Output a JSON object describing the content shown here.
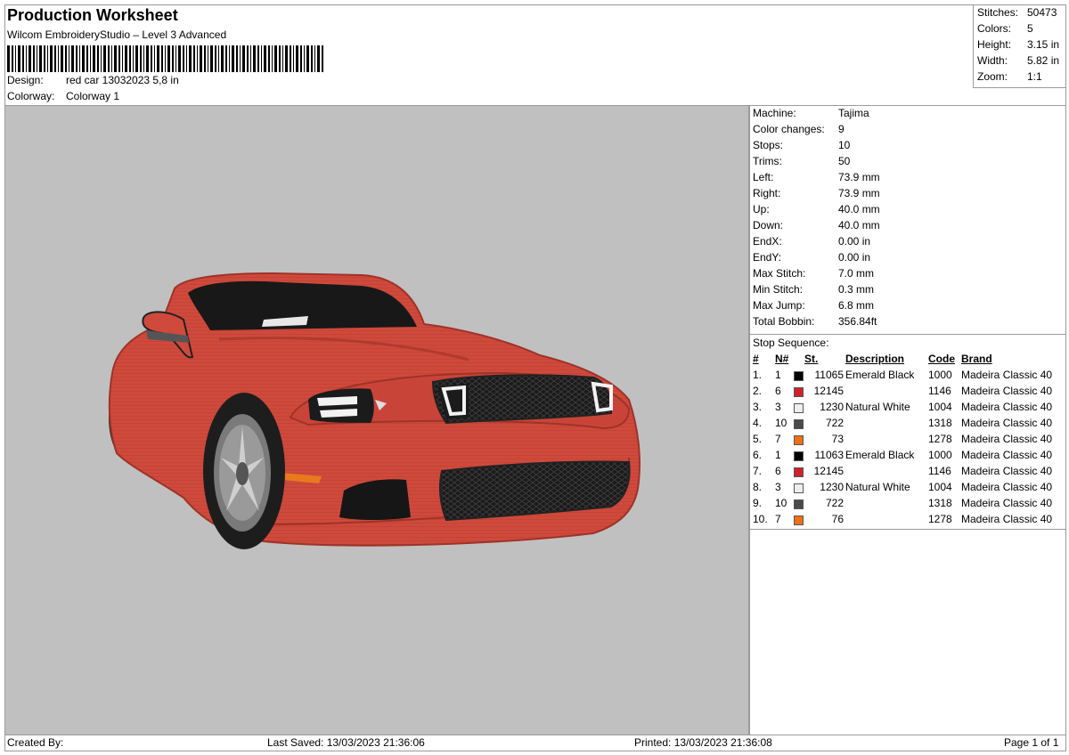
{
  "header": {
    "title": "Production Worksheet",
    "subtitle": "Wilcom EmbroideryStudio – Level 3 Advanced",
    "design_label": "Design:",
    "design_value": "red car 13032023 5,8 in",
    "colorway_label": "Colorway:",
    "colorway_value": "Colorway 1"
  },
  "stats": [
    {
      "label": "Stitches:",
      "value": "50473"
    },
    {
      "label": "Colors:",
      "value": "5"
    },
    {
      "label": "Height:",
      "value": "3.15 in"
    },
    {
      "label": "Width:",
      "value": "5.82 in"
    },
    {
      "label": "Zoom:",
      "value": "1:1"
    }
  ],
  "machine": [
    {
      "label": "Machine:",
      "value": "Tajima"
    },
    {
      "label": "Color changes:",
      "value": "9"
    },
    {
      "label": "Stops:",
      "value": "10"
    },
    {
      "label": "Trims:",
      "value": "50"
    },
    {
      "label": "Left:",
      "value": "73.9 mm"
    },
    {
      "label": "Right:",
      "value": "73.9 mm"
    },
    {
      "label": "Up:",
      "value": "40.0 mm"
    },
    {
      "label": "Down:",
      "value": "40.0 mm"
    },
    {
      "label": "EndX:",
      "value": "0.00 in"
    },
    {
      "label": "EndY:",
      "value": "0.00 in"
    },
    {
      "label": "Max Stitch:",
      "value": "7.0 mm"
    },
    {
      "label": "Min Stitch:",
      "value": "0.3 mm"
    },
    {
      "label": "Max Jump:",
      "value": "6.8 mm"
    },
    {
      "label": "Total Bobbin:",
      "value": "356.84ft"
    }
  ],
  "stop_sequence": {
    "title": "Stop Sequence:",
    "headers": {
      "idx": "#",
      "n": "N#",
      "st": "St.",
      "desc": "Description",
      "code": "Code",
      "brand": "Brand"
    },
    "rows": [
      {
        "idx": "1.",
        "n": "1",
        "color": "#000000",
        "st": "11065",
        "desc": "Emerald Black",
        "code": "1000",
        "brand": "Madeira Classic 40"
      },
      {
        "idx": "2.",
        "n": "6",
        "color": "#d0202a",
        "st": "12145",
        "desc": "",
        "code": "1146",
        "brand": "Madeira Classic 40"
      },
      {
        "idx": "3.",
        "n": "3",
        "color": "#eeeeee",
        "st": "1230",
        "desc": "Natural White",
        "code": "1004",
        "brand": "Madeira Classic 40"
      },
      {
        "idx": "4.",
        "n": "10",
        "color": "#4a4a4a",
        "st": "722",
        "desc": "",
        "code": "1318",
        "brand": "Madeira Classic 40"
      },
      {
        "idx": "5.",
        "n": "7",
        "color": "#f07018",
        "st": "73",
        "desc": "",
        "code": "1278",
        "brand": "Madeira Classic 40"
      },
      {
        "idx": "6.",
        "n": "1",
        "color": "#000000",
        "st": "11063",
        "desc": "Emerald Black",
        "code": "1000",
        "brand": "Madeira Classic 40"
      },
      {
        "idx": "7.",
        "n": "6",
        "color": "#d0202a",
        "st": "12145",
        "desc": "",
        "code": "1146",
        "brand": "Madeira Classic 40"
      },
      {
        "idx": "8.",
        "n": "3",
        "color": "#eeeeee",
        "st": "1230",
        "desc": "Natural White",
        "code": "1004",
        "brand": "Madeira Classic 40"
      },
      {
        "idx": "9.",
        "n": "10",
        "color": "#4a4a4a",
        "st": "722",
        "desc": "",
        "code": "1318",
        "brand": "Madeira Classic 40"
      },
      {
        "idx": "10.",
        "n": "7",
        "color": "#f07018",
        "st": "76",
        "desc": "",
        "code": "1278",
        "brand": "Madeira Classic 40"
      }
    ]
  },
  "footer": {
    "created_by": "Created By:",
    "last_saved": "Last Saved: 13/03/2023 21:36:06",
    "printed": "Printed: 13/03/2023 21:36:08",
    "page": "Page 1 of 1"
  },
  "colors": {
    "canvas_bg": "#c0c0c0",
    "car_body": "#cf4a3c",
    "border": "#9a9a9a"
  }
}
